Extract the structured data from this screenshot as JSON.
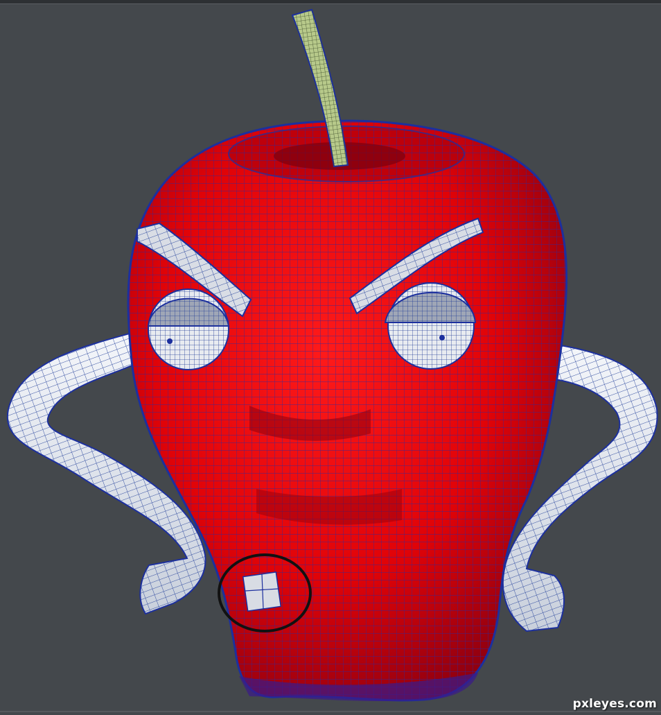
{
  "image": {
    "subject": "wireframe-apple-character",
    "background_color": "#44484c",
    "body_color": "#e0050a",
    "wire_color": "#1c2f9e",
    "limb_color": "#e6e9ef",
    "stem_color": "#b7c98a",
    "highlight_circle_color": "#111111"
  },
  "watermark": {
    "text": "pxleyes.com"
  }
}
